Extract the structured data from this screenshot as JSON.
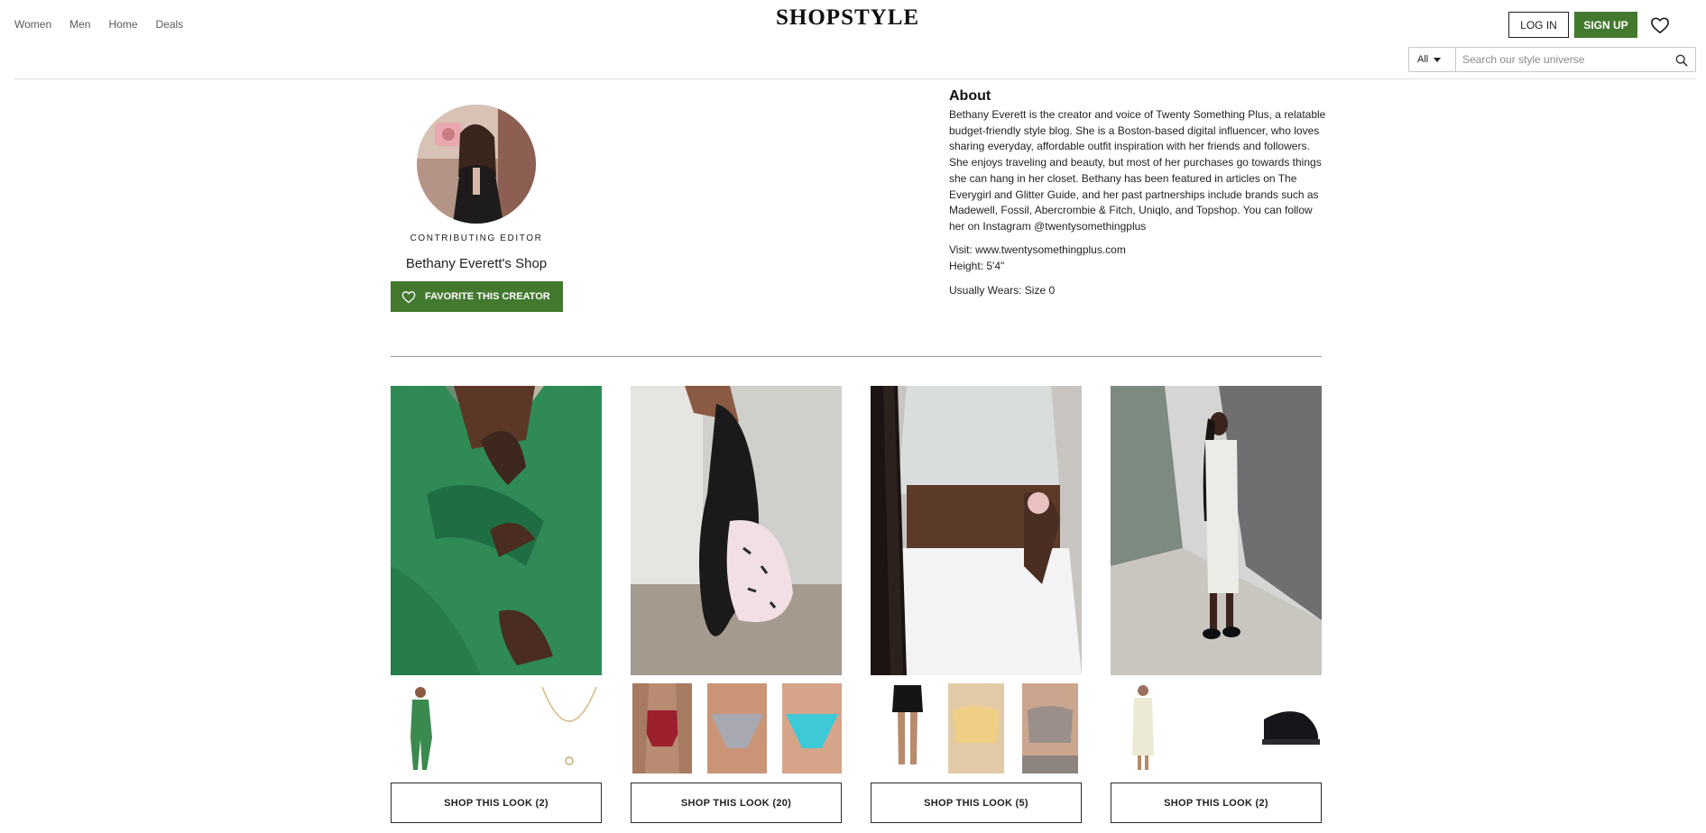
{
  "header": {
    "nav": [
      "Women",
      "Men",
      "Home",
      "Deals"
    ],
    "logo": "SHOPSTYLE",
    "login_label": "LOG IN",
    "signup_label": "SIGN UP",
    "search": {
      "scope": "All",
      "placeholder": "Search our style universe"
    }
  },
  "profile": {
    "role": "CONTRIBUTING EDITOR",
    "shop_name": "Bethany Everett's Shop",
    "favorite_label": "FAVORITE THIS CREATOR"
  },
  "about": {
    "title": "About",
    "bio": "Bethany Everett is the creator and voice of Twenty Something Plus, a relatable budget-friendly style blog. She is a Boston-based digital influencer, who loves sharing everyday, affordable outfit inspiration with her friends and followers. She enjoys traveling and beauty, but most of her purchases go towards things she can hang in her closet. Bethany has been featured in articles on The Everygirl and Glitter Guide, and her past partnerships include brands such as Madewell, Fossil, Abercrombie & Fitch, Uniqlo, and Topshop. You can follow her on Instagram @twentysomethingplus",
    "visit": "Visit: www.twentysomethingplus.com",
    "height": "Height: 5'4\"",
    "usually_wears": "Usually Wears: Size 0"
  },
  "looks": [
    {
      "button": "SHOP THIS LOOK (2)"
    },
    {
      "button": "SHOP THIS LOOK (20)"
    },
    {
      "button": "SHOP THIS LOOK (5)"
    },
    {
      "button": "SHOP THIS LOOK (2)"
    }
  ],
  "colors": {
    "brand_green": "#43792f",
    "text": "#1f1f1f",
    "muted": "#595959"
  }
}
